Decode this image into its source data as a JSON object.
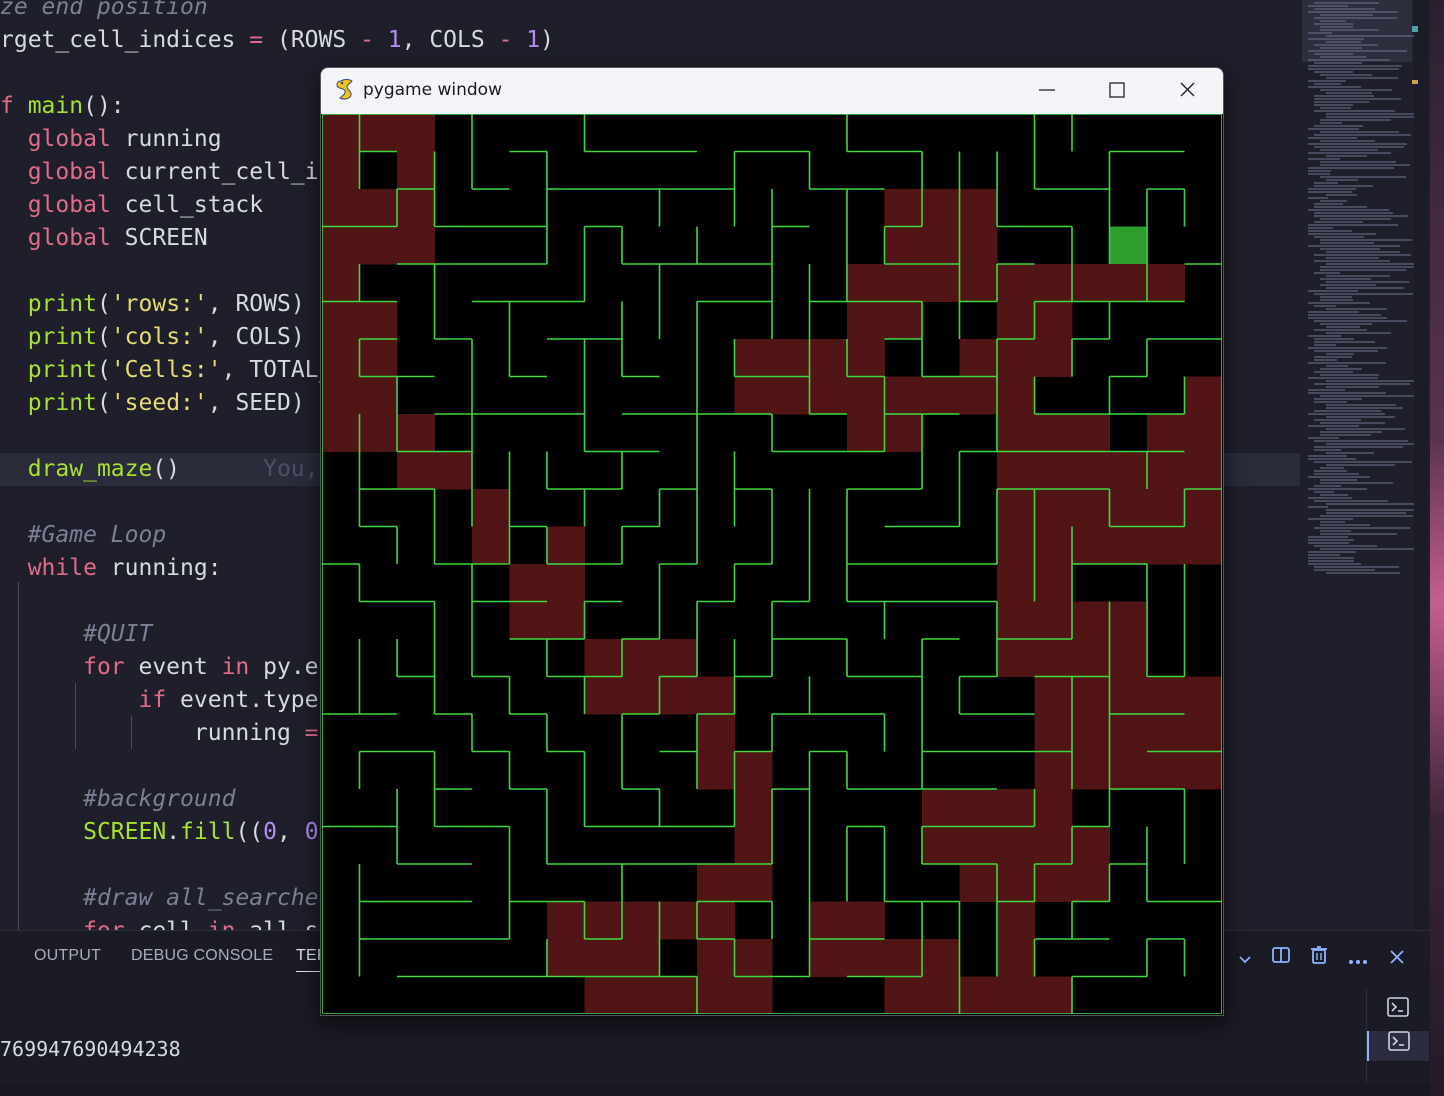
{
  "editor": {
    "lines": [
      [
        [
          "cm",
          "ze end position"
        ]
      ],
      [
        [
          "id",
          "rget_cell_indices "
        ],
        [
          "op",
          "= "
        ],
        [
          "id",
          "("
        ],
        [
          "id",
          "ROWS "
        ],
        [
          "op",
          "- "
        ],
        [
          "num",
          "1"
        ],
        [
          "id",
          ", "
        ],
        [
          "id",
          "COLS "
        ],
        [
          "op",
          "- "
        ],
        [
          "num",
          "1"
        ],
        [
          "id",
          ")"
        ]
      ],
      [],
      [
        [
          "kw",
          "f "
        ],
        [
          "fn",
          "main"
        ],
        [
          "id",
          "():"
        ]
      ],
      [
        [
          "id",
          "  "
        ],
        [
          "kw",
          "global "
        ],
        [
          "id",
          "running"
        ]
      ],
      [
        [
          "id",
          "  "
        ],
        [
          "kw",
          "global "
        ],
        [
          "id",
          "current_cell_in"
        ]
      ],
      [
        [
          "id",
          "  "
        ],
        [
          "kw",
          "global "
        ],
        [
          "id",
          "cell_stack"
        ]
      ],
      [
        [
          "id",
          "  "
        ],
        [
          "kw",
          "global "
        ],
        [
          "id",
          "SCREEN"
        ]
      ],
      [],
      [
        [
          "id",
          "  "
        ],
        [
          "fn",
          "print"
        ],
        [
          "id",
          "("
        ],
        [
          "str",
          "'rows:'"
        ],
        [
          "id",
          ", ROWS)"
        ]
      ],
      [
        [
          "id",
          "  "
        ],
        [
          "fn",
          "print"
        ],
        [
          "id",
          "("
        ],
        [
          "str",
          "'cols:'"
        ],
        [
          "id",
          ", COLS)"
        ]
      ],
      [
        [
          "id",
          "  "
        ],
        [
          "fn",
          "print"
        ],
        [
          "id",
          "("
        ],
        [
          "str",
          "'Cells:'"
        ],
        [
          "id",
          ", TOTAL_"
        ]
      ],
      [
        [
          "id",
          "  "
        ],
        [
          "fn",
          "print"
        ],
        [
          "id",
          "("
        ],
        [
          "str",
          "'seed:'"
        ],
        [
          "id",
          ", SEED)"
        ]
      ],
      [],
      [
        [
          "id",
          "  "
        ],
        [
          "fn",
          "draw_maze"
        ],
        [
          "id",
          "()"
        ],
        [
          "blame",
          "      You,"
        ]
      ],
      [],
      [
        [
          "id",
          "  "
        ],
        [
          "cm",
          "#Game Loop"
        ]
      ],
      [
        [
          "id",
          "  "
        ],
        [
          "kw",
          "while "
        ],
        [
          "id",
          "running:"
        ]
      ],
      [],
      [
        [
          "id",
          "      "
        ],
        [
          "cm",
          "#QUIT"
        ]
      ],
      [
        [
          "id",
          "      "
        ],
        [
          "kw",
          "for "
        ],
        [
          "id",
          "event "
        ],
        [
          "kw",
          "in "
        ],
        [
          "id",
          "py.ev"
        ]
      ],
      [
        [
          "id",
          "          "
        ],
        [
          "kw",
          "if "
        ],
        [
          "id",
          "event.type"
        ]
      ],
      [
        [
          "id",
          "              "
        ],
        [
          "id",
          "running "
        ],
        [
          "op",
          "="
        ]
      ],
      [],
      [
        [
          "id",
          "      "
        ],
        [
          "cm",
          "#background"
        ]
      ],
      [
        [
          "id",
          "      "
        ],
        [
          "fn",
          "SCREEN"
        ],
        [
          "id",
          "."
        ],
        [
          "fn",
          "fill"
        ],
        [
          "id",
          "(("
        ],
        [
          "num",
          "0"
        ],
        [
          "id",
          ", "
        ],
        [
          "num",
          "0"
        ],
        [
          "id",
          ","
        ]
      ],
      [],
      [
        [
          "id",
          "      "
        ],
        [
          "cm",
          "#draw all_searched"
        ]
      ],
      [
        [
          "id",
          "      "
        ],
        [
          "kw",
          "for "
        ],
        [
          "id",
          "cell "
        ],
        [
          "kw",
          "in "
        ],
        [
          "id",
          "all_se"
        ]
      ]
    ],
    "current_line": 14
  },
  "panel": {
    "tabs": [
      {
        "label": "OUTPUT",
        "active": false
      },
      {
        "label": "DEBUG CONSOLE",
        "active": false
      },
      {
        "label": "TERMINAL",
        "active": true
      }
    ],
    "terminal_output": "769947690494238",
    "actions": {
      "split_icon": "split-terminal-icon",
      "trash_icon": "trash-icon",
      "more_icon": "ellipsis-icon",
      "close_icon": "close-icon",
      "chevron_icon": "chevron-down-icon"
    }
  },
  "window": {
    "title": "pygame window",
    "icon": "pygame-snake-icon"
  },
  "maze": {
    "rows": 24,
    "cols": 24,
    "colors": {
      "background": "#000000",
      "wall": "#3ed83e",
      "searched": "#521515",
      "target": "#2e9e2e"
    },
    "target_cell": [
      3,
      21
    ],
    "searched_cells": [
      [
        0,
        0
      ],
      [
        0,
        1
      ],
      [
        0,
        2
      ],
      [
        1,
        0
      ],
      [
        1,
        2
      ],
      [
        2,
        0
      ],
      [
        2,
        1
      ],
      [
        2,
        2
      ],
      [
        3,
        0
      ],
      [
        3,
        1
      ],
      [
        3,
        2
      ],
      [
        4,
        0
      ],
      [
        5,
        0
      ],
      [
        5,
        1
      ],
      [
        6,
        0
      ],
      [
        6,
        1
      ],
      [
        7,
        0
      ],
      [
        7,
        1
      ],
      [
        8,
        0
      ],
      [
        8,
        1
      ],
      [
        8,
        2
      ],
      [
        9,
        2
      ],
      [
        9,
        3
      ],
      [
        10,
        4
      ],
      [
        11,
        4
      ],
      [
        11,
        6
      ],
      [
        12,
        5
      ],
      [
        12,
        6
      ],
      [
        13,
        5
      ],
      [
        13,
        6
      ],
      [
        14,
        7
      ],
      [
        14,
        8
      ],
      [
        14,
        9
      ],
      [
        15,
        7
      ],
      [
        15,
        8
      ],
      [
        15,
        9
      ],
      [
        15,
        10
      ],
      [
        16,
        10
      ],
      [
        17,
        10
      ],
      [
        17,
        11
      ],
      [
        18,
        11
      ],
      [
        19,
        11
      ],
      [
        20,
        10
      ],
      [
        20,
        11
      ],
      [
        21,
        6
      ],
      [
        21,
        7
      ],
      [
        21,
        8
      ],
      [
        21,
        9
      ],
      [
        21,
        10
      ],
      [
        22,
        6
      ],
      [
        22,
        7
      ],
      [
        22,
        8
      ],
      [
        22,
        10
      ],
      [
        22,
        11
      ],
      [
        23,
        7
      ],
      [
        23,
        8
      ],
      [
        23,
        9
      ],
      [
        23,
        10
      ],
      [
        23,
        11
      ],
      [
        2,
        15
      ],
      [
        2,
        16
      ],
      [
        2,
        17
      ],
      [
        3,
        15
      ],
      [
        3,
        16
      ],
      [
        3,
        17
      ],
      [
        4,
        14
      ],
      [
        4,
        15
      ],
      [
        4,
        16
      ],
      [
        4,
        17
      ],
      [
        4,
        18
      ],
      [
        4,
        19
      ],
      [
        4,
        20
      ],
      [
        4,
        21
      ],
      [
        4,
        22
      ],
      [
        5,
        14
      ],
      [
        5,
        15
      ],
      [
        5,
        18
      ],
      [
        5,
        19
      ],
      [
        6,
        11
      ],
      [
        6,
        12
      ],
      [
        6,
        13
      ],
      [
        6,
        14
      ],
      [
        6,
        17
      ],
      [
        6,
        18
      ],
      [
        6,
        19
      ],
      [
        7,
        11
      ],
      [
        7,
        12
      ],
      [
        7,
        13
      ],
      [
        7,
        14
      ],
      [
        7,
        15
      ],
      [
        7,
        16
      ],
      [
        7,
        17
      ],
      [
        7,
        18
      ],
      [
        7,
        23
      ],
      [
        8,
        14
      ],
      [
        8,
        15
      ],
      [
        8,
        18
      ],
      [
        8,
        19
      ],
      [
        8,
        20
      ],
      [
        8,
        22
      ],
      [
        8,
        23
      ],
      [
        9,
        18
      ],
      [
        9,
        19
      ],
      [
        9,
        20
      ],
      [
        9,
        21
      ],
      [
        9,
        22
      ],
      [
        9,
        23
      ],
      [
        10,
        18
      ],
      [
        10,
        19
      ],
      [
        10,
        20
      ],
      [
        10,
        21
      ],
      [
        10,
        22
      ],
      [
        10,
        23
      ],
      [
        11,
        18
      ],
      [
        11,
        19
      ],
      [
        11,
        20
      ],
      [
        11,
        21
      ],
      [
        11,
        22
      ],
      [
        11,
        23
      ],
      [
        12,
        18
      ],
      [
        12,
        19
      ],
      [
        13,
        18
      ],
      [
        13,
        19
      ],
      [
        13,
        20
      ],
      [
        13,
        21
      ],
      [
        14,
        18
      ],
      [
        14,
        19
      ],
      [
        14,
        20
      ],
      [
        14,
        21
      ],
      [
        15,
        19
      ],
      [
        15,
        20
      ],
      [
        15,
        21
      ],
      [
        15,
        22
      ],
      [
        15,
        23
      ],
      [
        16,
        19
      ],
      [
        16,
        20
      ],
      [
        16,
        21
      ],
      [
        16,
        22
      ],
      [
        16,
        23
      ],
      [
        17,
        19
      ],
      [
        17,
        20
      ],
      [
        17,
        21
      ],
      [
        17,
        22
      ],
      [
        17,
        23
      ],
      [
        18,
        16
      ],
      [
        18,
        17
      ],
      [
        18,
        18
      ],
      [
        18,
        19
      ],
      [
        19,
        16
      ],
      [
        19,
        17
      ],
      [
        19,
        18
      ],
      [
        19,
        19
      ],
      [
        19,
        20
      ],
      [
        20,
        17
      ],
      [
        20,
        18
      ],
      [
        20,
        19
      ],
      [
        20,
        20
      ],
      [
        21,
        13
      ],
      [
        21,
        14
      ],
      [
        21,
        18
      ],
      [
        22,
        13
      ],
      [
        22,
        14
      ],
      [
        22,
        15
      ],
      [
        22,
        16
      ],
      [
        22,
        18
      ],
      [
        23,
        15
      ],
      [
        23,
        16
      ],
      [
        23,
        17
      ],
      [
        23,
        18
      ],
      [
        23,
        19
      ]
    ]
  }
}
